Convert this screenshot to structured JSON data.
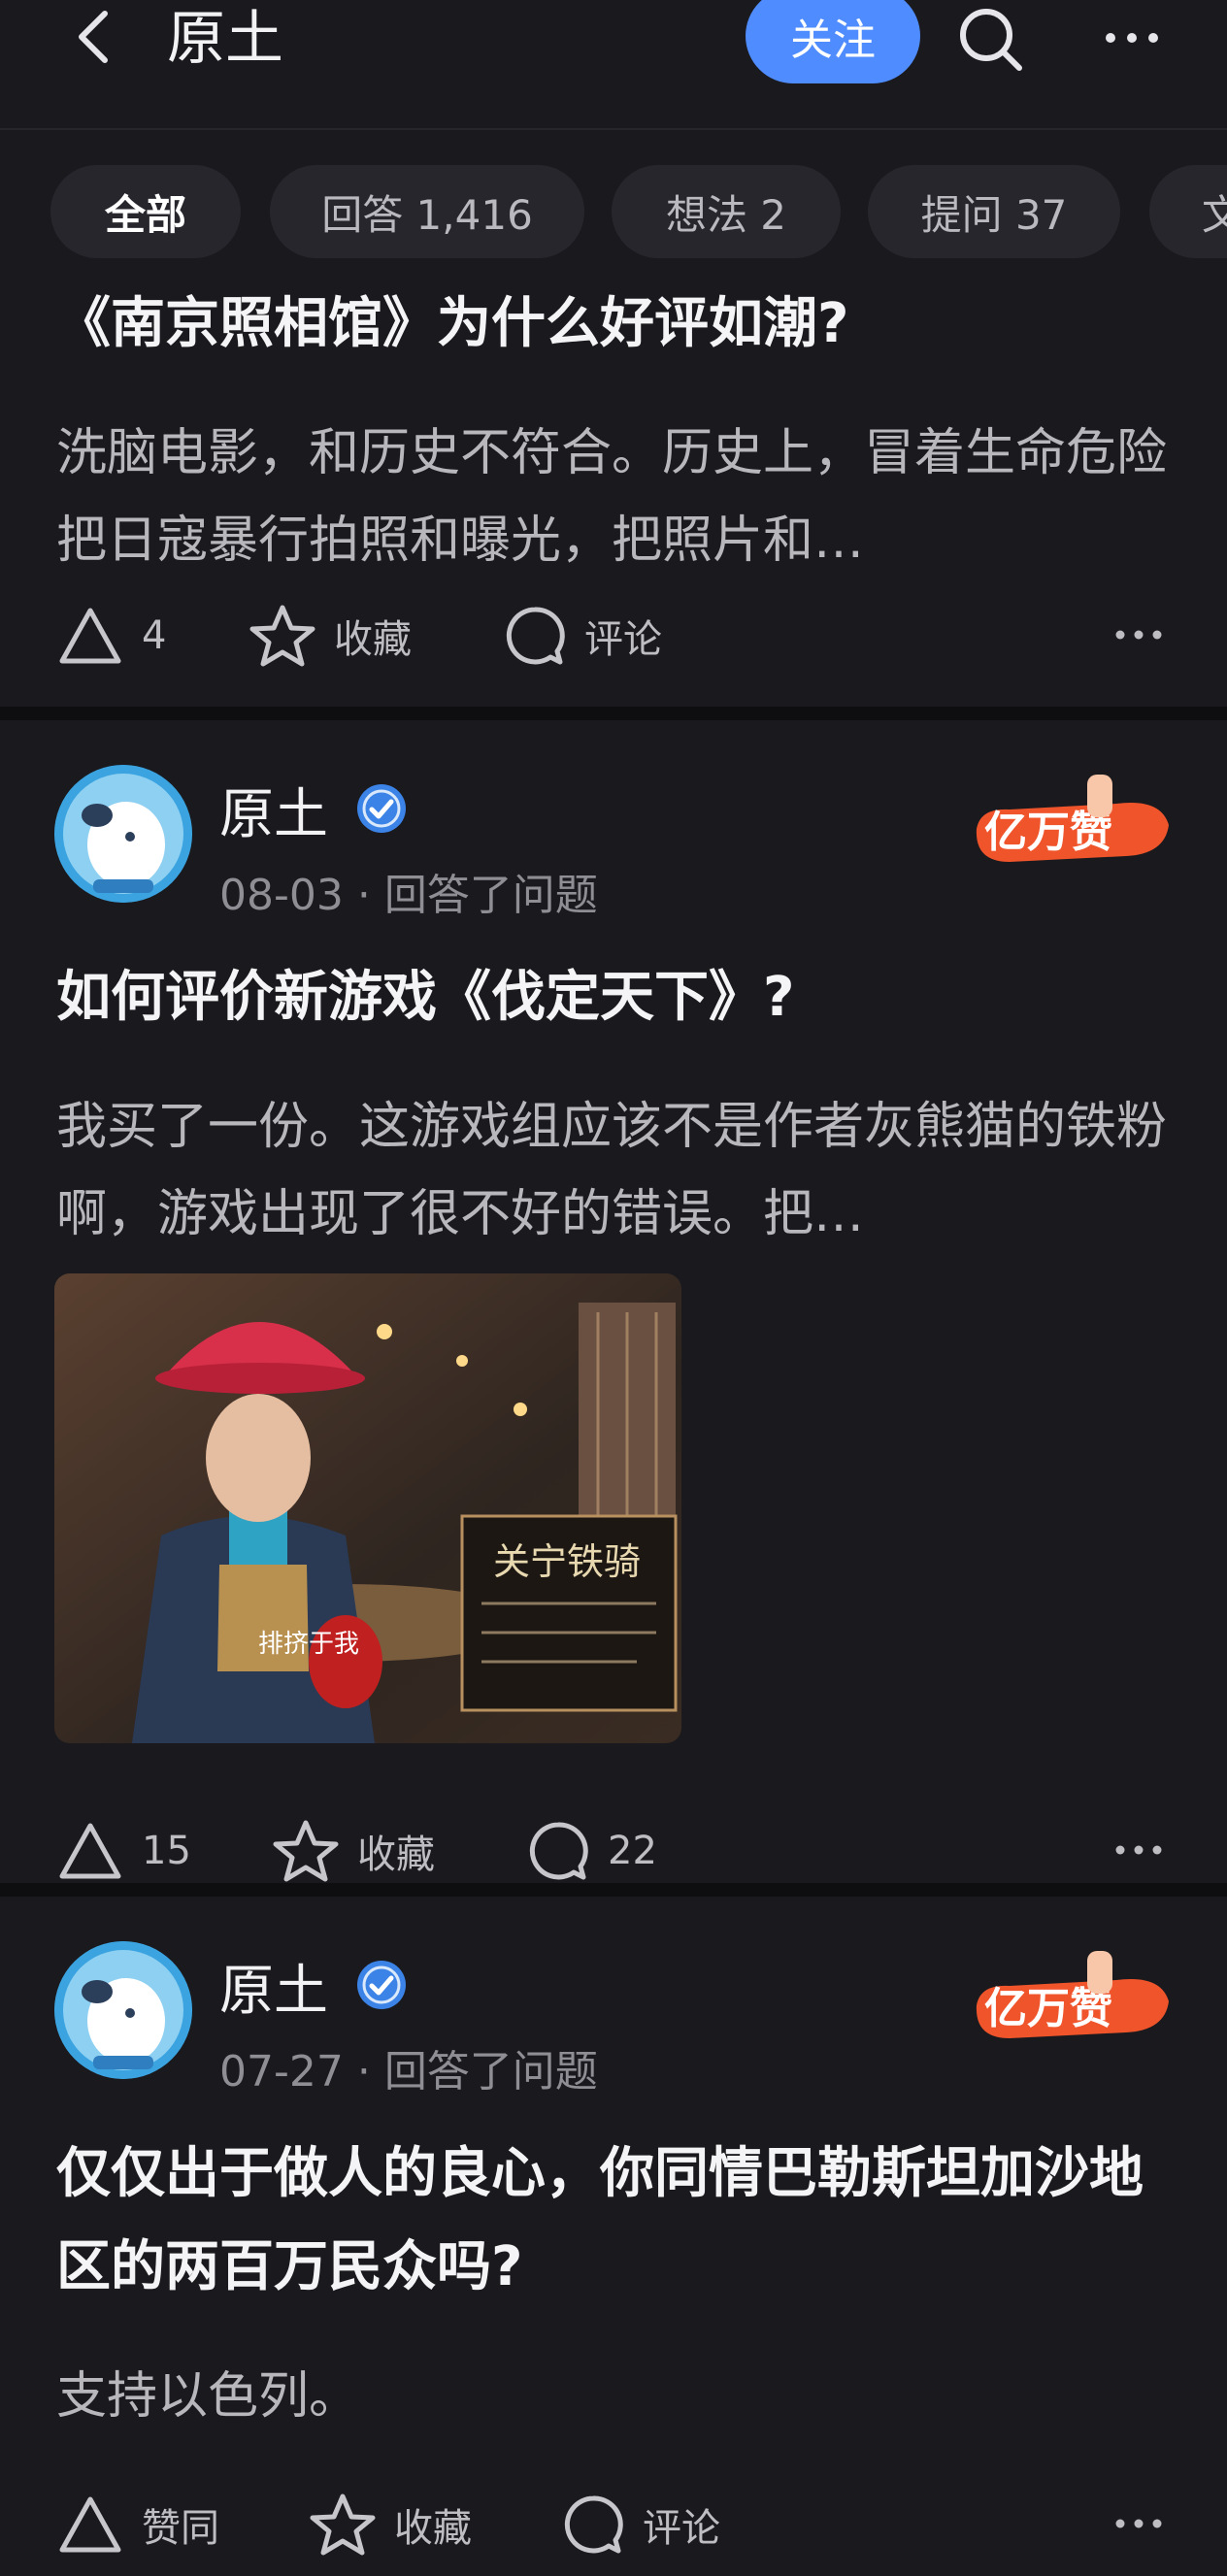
{
  "header": {
    "title": "原土",
    "follow_label": "关注"
  },
  "tabs": [
    {
      "label": "全部"
    },
    {
      "label": "回答 1,416"
    },
    {
      "label": "想法 2"
    },
    {
      "label": "提问 37"
    },
    {
      "label": "文"
    }
  ],
  "cards": [
    {
      "question": "《南京照相馆》为什么好评如潮?",
      "excerpt": "洗脑电影，和历史不符合。历史上，冒着生命危险把日寇暴行拍照和曝光，把照片和…",
      "actions": {
        "upvote": "4",
        "favorite": "收藏",
        "comment": "评论"
      }
    },
    {
      "author": "原土",
      "meta": "08-03 · 回答了问题",
      "badge_text": "亿万赞",
      "question": "如何评价新游戏《伐定天下》?",
      "excerpt": "我买了一份。这游戏组应该不是作者灰熊猫的铁粉啊，游戏出现了很不好的错误。把…",
      "image_caption": "关宁铁骑",
      "image_label": "排挤于我",
      "actions": {
        "upvote": "15",
        "favorite": "收藏",
        "comment": "22"
      }
    },
    {
      "author": "原土",
      "meta": "07-27 · 回答了问题",
      "badge_text": "亿万赞",
      "question": "仅仅出于做人的良心，你同情巴勒斯坦加沙地区的两百万民众吗?",
      "excerpt": "支持以色列。",
      "actions": {
        "upvote": "赞同",
        "favorite": "收藏",
        "comment": "评论"
      }
    }
  ],
  "colors": {
    "background": "#0e0e10",
    "card": "#1a1a1e",
    "accent": "#4f8cff",
    "badge": "#f0542b"
  },
  "icons": [
    "back-icon",
    "search-icon",
    "more-icon",
    "upvote-icon",
    "star-icon",
    "comment-icon",
    "verified-icon"
  ]
}
